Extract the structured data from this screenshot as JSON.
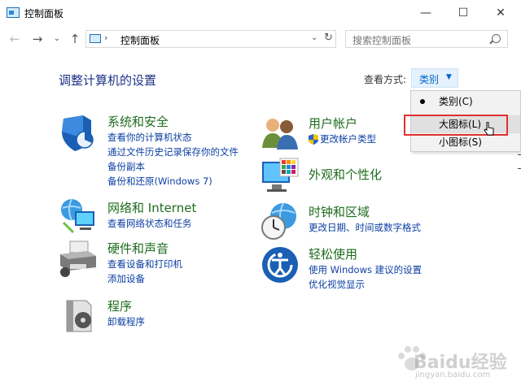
{
  "window": {
    "title": "控制面板",
    "minimize_glyph": "—",
    "maximize_glyph": "☐",
    "close_glyph": "✕"
  },
  "nav": {
    "back_glyph": "←",
    "forward_glyph": "→",
    "recent_glyph": "⌄",
    "up_glyph": "↑",
    "address_sep": "›",
    "address_text": "控制面板",
    "address_dropdown_glyph": "⌄",
    "refresh_glyph": "↻",
    "search_placeholder": "搜索控制面板"
  },
  "main": {
    "heading": "调整计算机的设置",
    "view_by_label": "查看方式:",
    "view_by_value": "类别",
    "view_by_arrow": "▼"
  },
  "categories": [
    {
      "title": "系统和安全",
      "links": [
        "查看你的计算机状态",
        "通过文件历史记录保存你的文件",
        "备份副本",
        "备份和还原(Windows 7)"
      ]
    },
    {
      "title": "网络和 Internet",
      "links": [
        "查看网络状态和任务"
      ]
    },
    {
      "title": "硬件和声音",
      "links": [
        "查看设备和打印机",
        "添加设备"
      ]
    },
    {
      "title": "程序",
      "links": [
        "卸载程序"
      ]
    },
    {
      "title": "用户帐户",
      "links": [
        "更改帐户类型"
      ]
    },
    {
      "title": "外观和个性化",
      "links": []
    },
    {
      "title": "时钟和区域",
      "links": [
        "更改日期、时间或数字格式"
      ]
    },
    {
      "title": "轻松使用",
      "links": [
        "使用 Windows 建议的设置",
        "优化视觉显示"
      ]
    }
  ],
  "view_menu": {
    "items": [
      {
        "label": "类别(C)",
        "selected": true
      },
      {
        "label": "大图标(L)",
        "selected": false
      },
      {
        "label": "小图标(S)",
        "selected": false
      }
    ]
  },
  "watermark": {
    "text": "Baidu经验",
    "sub": "jingyan.baidu.com"
  },
  "colors": {
    "category_title": "#1e6c1e",
    "link": "#0b3fa3",
    "heading": "#1e3287",
    "highlight_box": "#e03030"
  }
}
